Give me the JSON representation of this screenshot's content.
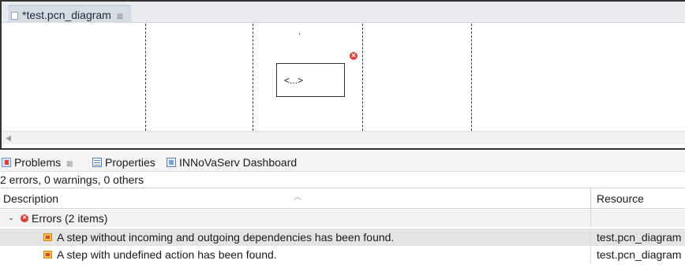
{
  "editor": {
    "tab_label": "*test.pcn_diagram",
    "tab_close": "⊠",
    "diagram": {
      "step_label": "<...>"
    }
  },
  "views": {
    "tabs": [
      {
        "label": "Problems",
        "close": "⊠"
      },
      {
        "label": "Properties"
      },
      {
        "label": "INNoVaServ Dashboard"
      }
    ]
  },
  "problems": {
    "summary": "2 errors, 0 warnings, 0 others",
    "columns": {
      "description": "Description",
      "resource": "Resource"
    },
    "group": {
      "label": "Errors (2 items)"
    },
    "items": [
      {
        "description": "A step without incoming and outgoing dependencies has been found.",
        "resource": "test.pcn_diagram"
      },
      {
        "description": "A step with undefined action has been found.",
        "resource": "test.pcn_diagram"
      }
    ]
  },
  "colors": {
    "error": "#d9403a",
    "selected_row": "#e4e4e4",
    "tab_active": "#d6dce4"
  }
}
